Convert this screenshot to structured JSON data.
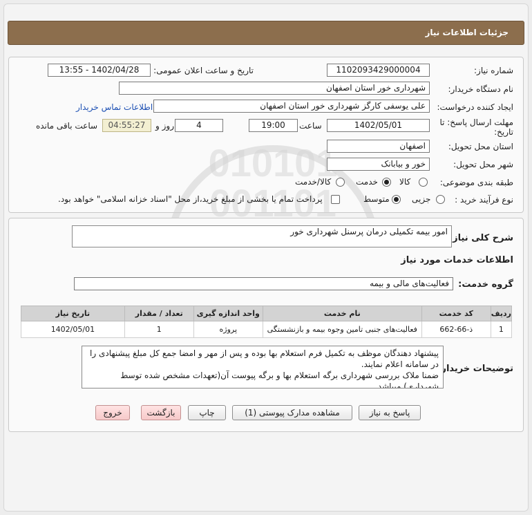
{
  "header": {
    "title": "جزئیات اطلاعات نیاز"
  },
  "fields": {
    "need_number_label": "شماره نیاز:",
    "need_number": "1102093429000004",
    "announce_label": "تاریخ و ساعت اعلان عمومی:",
    "announce_value": "1402/04/28 - 13:55",
    "buyer_org_label": "نام دستگاه خریدار:",
    "buyer_org": "شهرداری خور استان اصفهان",
    "creator_label": "ایجاد کننده درخواست:",
    "creator": "علی یوسفی کارگز  شهرداری خور استان اصفهان",
    "contact_link": "اطلاعات تماس خریدار",
    "deadline_label_1": "مهلت ارسال پاسخ: تا",
    "deadline_label_2": "تاریخ:",
    "deadline_date": "1402/05/01",
    "time_label": "ساعت",
    "deadline_time": "19:00",
    "days_value": "4",
    "days_label": "روز و",
    "remaining_time": "04:55:27",
    "remaining_label": "ساعت باقی مانده",
    "province_label": "استان محل تحویل:",
    "province": "اصفهان",
    "city_label": "شهر محل تحویل:",
    "city": "خور و بیابانک",
    "category_label": "طبقه بندی موضوعی:",
    "category_options": [
      "کالا",
      "خدمت",
      "کالا/خدمت"
    ],
    "category_selected": "خدمت",
    "process_label": "نوع فرآیند خرید :",
    "process_options": [
      "جزیی",
      "متوسط"
    ],
    "process_selected": "متوسط",
    "payment_note": "پرداخت تمام یا بخشی از مبلغ خرید،از محل \"اسناد خزانه اسلامی\" خواهد بود."
  },
  "need": {
    "summary_label": "شرح کلی نیاز:",
    "summary": "امور بیمه تکمیلی درمان پرسنل شهرداری خور",
    "services_heading": "اطلاعات خدمات مورد نیاز",
    "service_group_label": "گروه خدمت:",
    "service_group": "فعالیت‌های مالی و بیمه"
  },
  "table": {
    "headers": [
      "ردیف",
      "کد خدمت",
      "نام خدمت",
      "واحد اندازه گیری",
      "تعداد / مقدار",
      "تاریخ نیاز"
    ],
    "rows": [
      [
        "1",
        "ذ-66-662",
        "فعالیت‌های جنبی تامین وجوه بیمه و بازنشستگی",
        "پروژه",
        "1",
        "1402/05/01"
      ]
    ]
  },
  "buyer_notes": {
    "label": "توضیحات خریدار:",
    "lines": [
      "پیشنهاد دهندگان موظف به تکمیل فرم استعلام بها بوده و پس از مهر و امضا جمع کل مبلغ پیشنهادی را",
      "در سامانه اعلام نمایند.",
      "ضمنا ملاک بررسی شهرداری برگه استعلام بها و برگه پیوست آن(تعهدات مشخص شده توسط",
      "شهرداری) میباشد."
    ]
  },
  "buttons": {
    "reply": "پاسخ به نیاز",
    "view_docs": "مشاهده مدارک پیوستی (1)",
    "print": "چاپ",
    "back": "بازگشت",
    "exit": "خروج"
  }
}
